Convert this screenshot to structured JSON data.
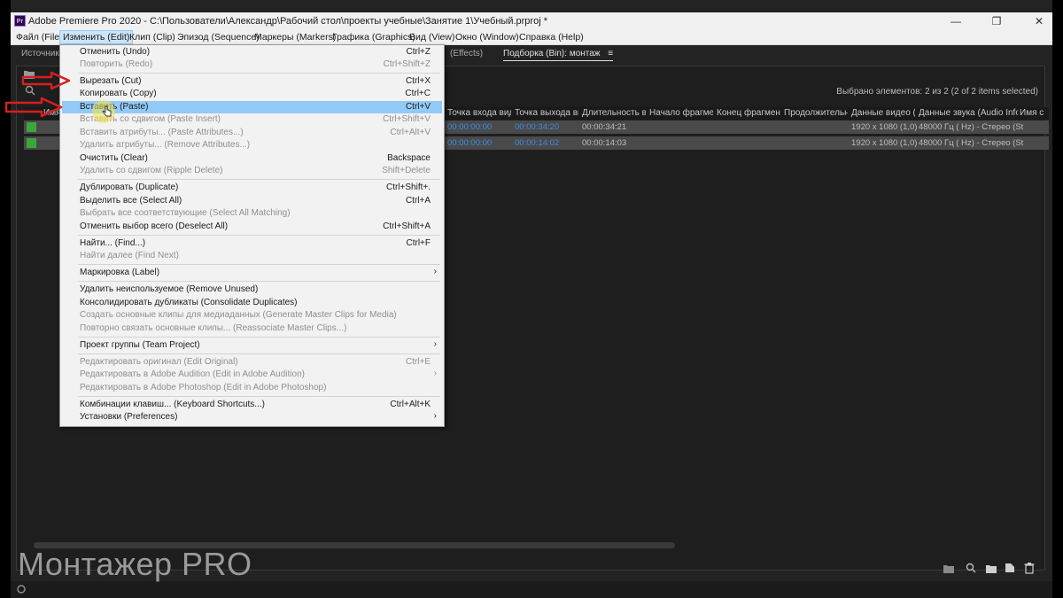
{
  "window": {
    "title": "Adobe Premiere Pro 2020 - C:\\Пользователи\\Александр\\Рабочий стол\\проекты учебные\\Занятие 1\\Учебный.prproj *",
    "app_icon": "Pr",
    "minimize": "—",
    "maximize": "❐",
    "close": "✕"
  },
  "menubar": [
    "Файл (File)",
    "Изменить (Edit)",
    "Клип (Clip)",
    "Эпизод (Sequence)",
    "Маркеры (Markers)",
    "Графика (Graphics)",
    "Вид (View)",
    "Окно (Window)",
    "Справка (Help)"
  ],
  "panel_tabs": {
    "source": "Источник:",
    "effects": "(Effects)",
    "bin": "Подборка (Bin): монтаж",
    "bin_menu_icon": "≡"
  },
  "bin": {
    "selection_info": "Выбрано элементов: 2 из 2 (2 of 2 items selected)",
    "columns": [
      "Имя",
      "Точка входа виде",
      "Точка выхода вид",
      "Длительность ви",
      "Начало фрагмент",
      "Конец фрагмента",
      "Продолжительнос",
      "Данные видео (Vi",
      "Данные звука (Audio Info)",
      "Имя с"
    ],
    "rows": [
      {
        "in": "00:00:00:00",
        "out": "00:00:34:20",
        "duration": "00:00:34:21",
        "video_info": "1920 x 1080 (1,0)",
        "audio_info": "48000 Гц ( Hz) - Стерео (St"
      },
      {
        "in": "00:00:00:00",
        "out": "00:00:14:02",
        "duration": "00:00:14:03",
        "video_info": "1920 x 1080 (1,0)",
        "audio_info": "48000 Гц ( Hz) - Стерео (St"
      }
    ],
    "label_color": "#3aa838"
  },
  "edit_menu": {
    "items": [
      {
        "label": "Отменить (Undo)",
        "shortcut": "Ctrl+Z",
        "disabled": false
      },
      {
        "label": "Повторить (Redo)",
        "shortcut": "Ctrl+Shift+Z",
        "disabled": true
      },
      {
        "label": "Вырезать (Cut)",
        "shortcut": "Ctrl+X",
        "disabled": false
      },
      {
        "label": "Копировать (Copy)",
        "shortcut": "Ctrl+C",
        "disabled": false
      },
      {
        "label": "Вставить (Paste)",
        "shortcut": "Ctrl+V",
        "disabled": false,
        "highlighted": true
      },
      {
        "label": "Вставить со сдвигом (Paste Insert)",
        "shortcut": "Ctrl+Shift+V",
        "disabled": true
      },
      {
        "label": "Вставить атрибуты... (Paste Attributes...)",
        "shortcut": "Ctrl+Alt+V",
        "disabled": true
      },
      {
        "label": "Удалить атрибуты... (Remove Attributes...)",
        "shortcut": "",
        "disabled": true
      },
      {
        "label": "Очистить (Clear)",
        "shortcut": "Backspace",
        "disabled": false
      },
      {
        "label": "Удалить со сдвигом (Ripple Delete)",
        "shortcut": "Shift+Delete",
        "disabled": true
      },
      {
        "label": "Дублировать (Duplicate)",
        "shortcut": "Ctrl+Shift+.",
        "disabled": false
      },
      {
        "label": "Выделить все (Select All)",
        "shortcut": "Ctrl+A",
        "disabled": false
      },
      {
        "label": "Выбрать все соответствующие (Select All Matching)",
        "shortcut": "",
        "disabled": true
      },
      {
        "label": "Отменить выбор всего (Deselect All)",
        "shortcut": "Ctrl+Shift+A",
        "disabled": false
      },
      {
        "label": "Найти... (Find...)",
        "shortcut": "Ctrl+F",
        "disabled": false
      },
      {
        "label": "Найти далее (Find Next)",
        "shortcut": "",
        "disabled": true
      },
      {
        "label": "Маркировка (Label)",
        "shortcut": "",
        "disabled": false,
        "submenu": true
      },
      {
        "label": "Удалить неиспользуемое (Remove Unused)",
        "shortcut": "",
        "disabled": false
      },
      {
        "label": "Консолидировать дубликаты (Consolidate Duplicates)",
        "shortcut": "",
        "disabled": false
      },
      {
        "label": "Создать основные клипы для медиаданных (Generate Master Clips for Media)",
        "shortcut": "",
        "disabled": true
      },
      {
        "label": "Повторно связать основные клипы... (Reassociate Master Clips...)",
        "shortcut": "",
        "disabled": true
      },
      {
        "label": "Проект группы (Team Project)",
        "shortcut": "",
        "disabled": false,
        "submenu": true
      },
      {
        "label": "Редактировать оригинал (Edit Original)",
        "shortcut": "Ctrl+E",
        "disabled": true
      },
      {
        "label": "Редактировать в Adobe Audition (Edit in Adobe Audition)",
        "shortcut": "",
        "disabled": true,
        "submenu": true
      },
      {
        "label": "Редактировать в Adobe Photoshop (Edit in Adobe Photoshop)",
        "shortcut": "",
        "disabled": true
      },
      {
        "label": "Комбинации клавиш... (Keyboard Shortcuts...)",
        "shortcut": "Ctrl+Alt+K",
        "disabled": false
      },
      {
        "label": "Установки (Preferences)",
        "shortcut": "",
        "disabled": false,
        "submenu": true
      }
    ],
    "submenu_arrow": "›",
    "highlight_color": "#91c9f7"
  },
  "watermark": "Монтажер PRO",
  "icons": {
    "bottom_right": [
      "folder-icon",
      "search-icon",
      "new-bin-icon",
      "new-item-icon",
      "trash-icon"
    ],
    "status": "sync-icon"
  },
  "annotation_color": "#d42020"
}
